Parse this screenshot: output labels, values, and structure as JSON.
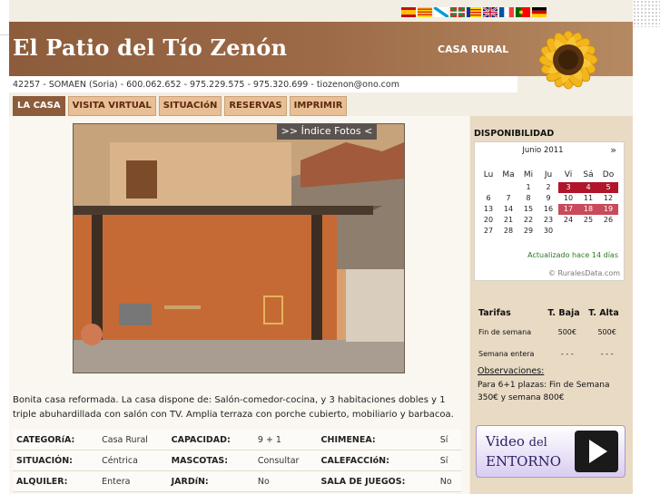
{
  "site": {
    "title": "El Patio del Tío Zenón",
    "subtitle": "CASA RURAL",
    "contact": "42257 - SOMAEN (Soria) - 600.062.652 - 975.229.575 - 975.320.699 - tiozenon@ono.com"
  },
  "languages": [
    "es",
    "ca",
    "gl",
    "eu",
    "va",
    "en",
    "fr",
    "pt",
    "de"
  ],
  "nav": [
    {
      "label": "LA CASA"
    },
    {
      "label": "VISITA VIRTUAL"
    },
    {
      "label": "SITUACIóN"
    },
    {
      "label": "RESERVAS"
    },
    {
      "label": "IMPRIMIR"
    }
  ],
  "gallery": {
    "index_button": ">> Índice Fotos <"
  },
  "description": "Bonita casa reformada. La casa dispone de: Salón-comedor-cocina, y 3 habitaciones dobles y 1 triple abuhardillada con salón con TV. Amplia terraza con porche cubierto, mobiliario y barbacoa.",
  "specs": [
    [
      {
        "label": "CATEGORíA:",
        "value": "Casa Rural"
      },
      {
        "label": "CAPACIDAD:",
        "value": "9 + 1"
      },
      {
        "label": "CHIMENEA:",
        "value": "Sí"
      }
    ],
    [
      {
        "label": "SITUACIÓN:",
        "value": "Céntrica"
      },
      {
        "label": "MASCOTAS:",
        "value": "Consultar"
      },
      {
        "label": "CALEFACCIóN:",
        "value": "Sí"
      }
    ],
    [
      {
        "label": "ALQUILER:",
        "value": "Entera"
      },
      {
        "label": "JARDíN:",
        "value": "No"
      },
      {
        "label": "SALA DE JUEGOS:",
        "value": "No"
      }
    ]
  ],
  "availability": {
    "title": "DISPONIBILIDAD",
    "month": "Junio 2011",
    "next": "»",
    "day_headers": [
      "Lu",
      "Ma",
      "Mi",
      "Ju",
      "Vi",
      "Sá",
      "Do"
    ],
    "weeks": [
      [
        "",
        "",
        "1",
        "2",
        "3",
        "4",
        "5"
      ],
      [
        "6",
        "7",
        "8",
        "9",
        "10",
        "11",
        "12"
      ],
      [
        "13",
        "14",
        "15",
        "16",
        "17",
        "18",
        "19"
      ],
      [
        "20",
        "21",
        "22",
        "23",
        "24",
        "25",
        "26"
      ],
      [
        "27",
        "28",
        "29",
        "30",
        "",
        "",
        ""
      ]
    ],
    "busy_days": [
      "3",
      "4",
      "5",
      "17",
      "18",
      "19"
    ],
    "updated": "Actualizado hace 14 días",
    "credit": "© RuralesData.com",
    "busy_color": "#b0152a"
  },
  "rates": {
    "headers": [
      "Tarifas",
      "T. Baja",
      "T. Alta"
    ],
    "rows": [
      [
        "Fin de semana",
        "500€",
        "500€"
      ],
      [
        "Semana entera",
        "- - -",
        "- - -"
      ]
    ]
  },
  "observations": {
    "title": "Observaciones:",
    "text": "Para 6+1 plazas: Fin de Semana 350€ y semana 800€"
  },
  "video": {
    "line1": "Video",
    "line1_small": "del",
    "line2": "ENTORNO"
  },
  "colors": {
    "brand": "#8c5c3c",
    "nav_tab": "#e9bf95",
    "sidebar": "#e9dac4"
  }
}
